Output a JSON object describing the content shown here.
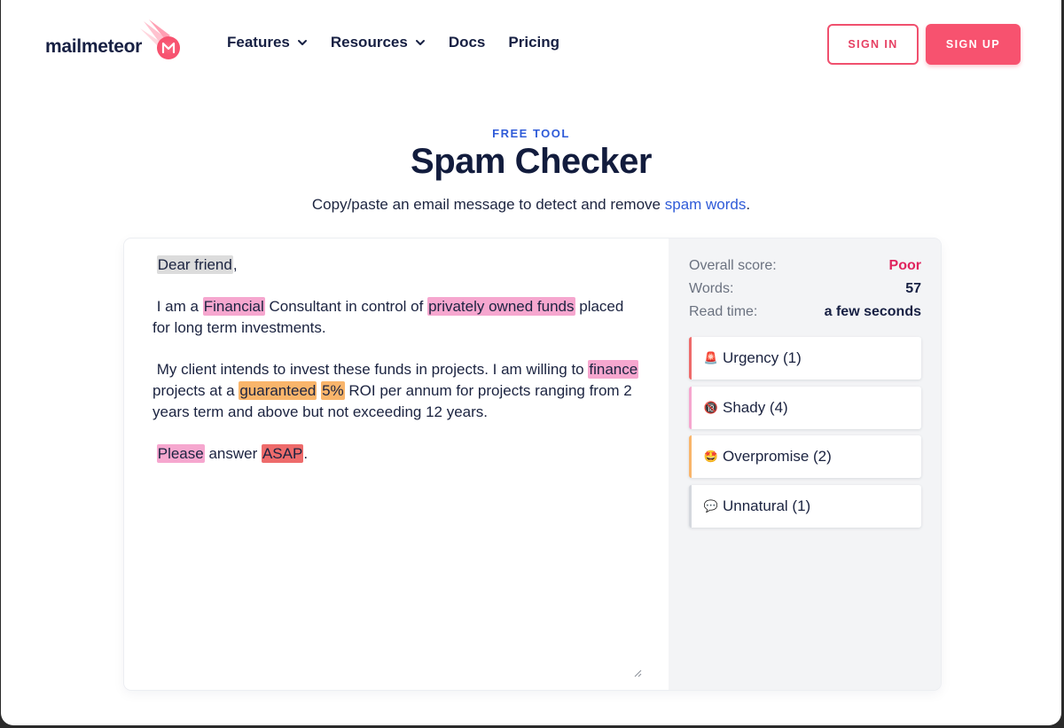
{
  "nav": {
    "logo_text": "mailmeteor",
    "links": [
      {
        "label": "Features",
        "dropdown": true
      },
      {
        "label": "Resources",
        "dropdown": true
      },
      {
        "label": "Docs",
        "dropdown": false
      },
      {
        "label": "Pricing",
        "dropdown": false
      }
    ],
    "signin_label": "SIGN IN",
    "signup_label": "SIGN UP"
  },
  "hero": {
    "eyebrow": "FREE TOOL",
    "title": "Spam Checker",
    "subtitle_pre": "Copy/paste an email message to detect and remove ",
    "subtitle_link": "spam words",
    "subtitle_post": "."
  },
  "editor": {
    "greeting": "Dear friend",
    "greeting_tail": ",",
    "p1": {
      "t0": "I am a ",
      "w1": "Financial",
      "t1": " Consultant in control of ",
      "w2": "privately owned funds",
      "t2": " placed for long term investments."
    },
    "p2": {
      "t0": "My client intends to invest these funds in projects. I am willing to ",
      "w1": "finance",
      "t1": " projects at a ",
      "w2": "guaranteed",
      "t2": " ",
      "w3": "5%",
      "t3": " ROI per annum for projects ranging from 2 years term and above but not exceeding 12 years."
    },
    "p3": {
      "w1": "Please",
      "t1": " answer ",
      "w2": "ASAP",
      "t2": "."
    }
  },
  "stats": {
    "score_label": "Overall score:",
    "score_value": "Poor",
    "words_label": "Words:",
    "words_value": "57",
    "read_label": "Read time:",
    "read_value": "a few seconds"
  },
  "categories": [
    {
      "icon": "🚨",
      "label": "Urgency (1)",
      "color": "#ee6b6b"
    },
    {
      "icon": "🔞",
      "label": "Shady (4)",
      "color": "#f6a7cf"
    },
    {
      "icon": "🤩",
      "label": "Overpromise (2)",
      "color": "#f9b56b"
    },
    {
      "icon": "💬",
      "label": "Unnatural (1)",
      "color": "#d5d8de"
    }
  ],
  "colors": {
    "brand": "#f7526f",
    "link": "#2f5bd8",
    "highlight_gray": "#dcdcdc",
    "highlight_pink": "#f6a7cf",
    "highlight_orange": "#f9b56b",
    "highlight_red": "#ee6b6b"
  }
}
